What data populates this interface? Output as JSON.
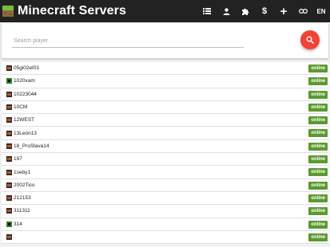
{
  "header": {
    "title": "Minecraft Servers",
    "nav_icons": [
      "list-icon",
      "user-icon",
      "puzzle-icon",
      "dollar-icon",
      "plus-icon",
      "link-icon"
    ],
    "dollar_glyph": "$",
    "plus_glyph": "+",
    "lang": "EN"
  },
  "search": {
    "placeholder": "Search player",
    "value": ""
  },
  "status_color": "#5b9a2f",
  "accent_color": "#f44336",
  "servers": [
    {
      "name": "05gi02el03",
      "icon": "dark",
      "status": "online"
    },
    {
      "name": "1020xam",
      "icon": "green",
      "status": "online"
    },
    {
      "name": "10223044",
      "icon": "dark",
      "status": "online"
    },
    {
      "name": "10CM",
      "icon": "dark",
      "status": "online"
    },
    {
      "name": "12WEST",
      "icon": "dark",
      "status": "online"
    },
    {
      "name": "13Leon13",
      "icon": "dark",
      "status": "online"
    },
    {
      "name": "18_ProSlava14",
      "icon": "dark",
      "status": "online"
    },
    {
      "name": "197",
      "icon": "dark",
      "status": "online"
    },
    {
      "name": "1seby1",
      "icon": "dark",
      "status": "online"
    },
    {
      "name": "2002Tico",
      "icon": "dark",
      "status": "online"
    },
    {
      "name": "212153",
      "icon": "dark",
      "status": "online"
    },
    {
      "name": "311311",
      "icon": "dark",
      "status": "online"
    },
    {
      "name": "314",
      "icon": "green",
      "status": "online"
    },
    {
      "name": "",
      "icon": "dark",
      "status": "online"
    }
  ]
}
